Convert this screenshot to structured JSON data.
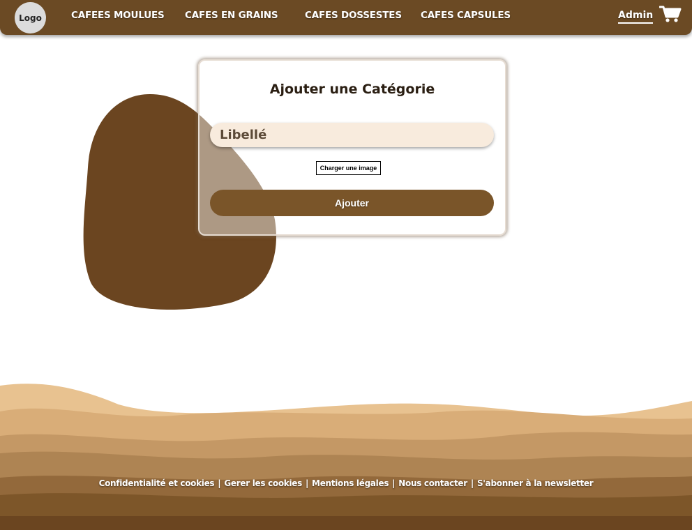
{
  "header": {
    "logo_label": "Logo",
    "nav": [
      {
        "label": "CAFEES MOULUES"
      },
      {
        "label": "CAFES EN GRAINS"
      },
      {
        "label": "CAFES DOSSESTES"
      },
      {
        "label": "CAFES CAPSULES"
      }
    ],
    "admin_label": "Admin",
    "cart_icon": "shopping-cart-icon"
  },
  "form": {
    "title": "Ajouter une Catégorie",
    "libelle_placeholder": "Libellé",
    "libelle_value": "",
    "upload_label": "Charger une image",
    "submit_label": "Ajouter"
  },
  "footer": {
    "links": [
      {
        "label": "Confidentialité et cookies"
      },
      {
        "label": "Gerer les cookies"
      },
      {
        "label": "Mentions légales"
      },
      {
        "label": "Nous contacter"
      },
      {
        "label": "S'abonner à la newsletter"
      }
    ],
    "separator": "|"
  },
  "colors": {
    "brand_brown": "#6b4a24",
    "button_brown": "#7a5529",
    "input_bg": "#f8ebdd",
    "sand_light": "#e8c08c"
  }
}
